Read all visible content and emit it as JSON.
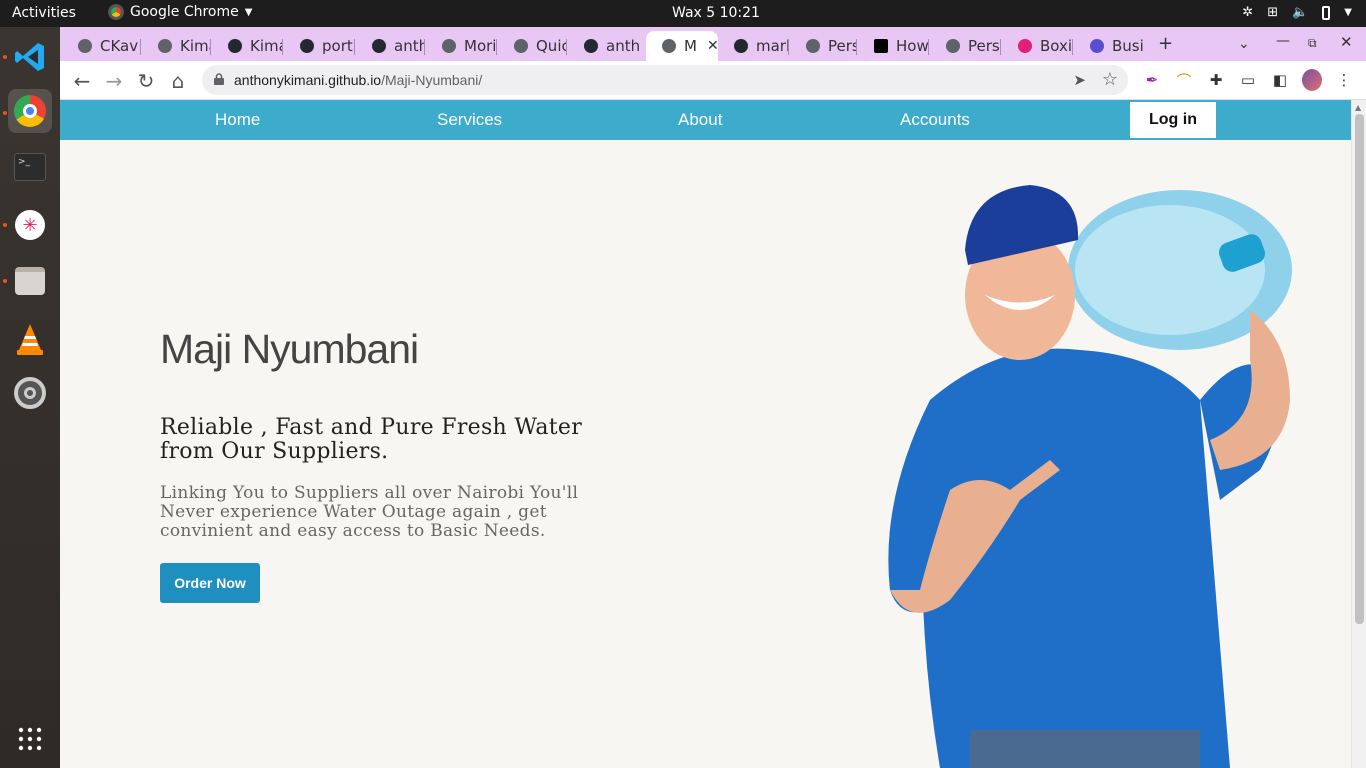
{
  "system": {
    "activities": "Activities",
    "app_name": "Google Chrome",
    "clock": "Wax 5  10:21"
  },
  "tabs": [
    {
      "label": "CKav",
      "icon": "globe-icon"
    },
    {
      "label": "Kima",
      "icon": "globe-icon"
    },
    {
      "label": "Kima",
      "icon": "github-icon"
    },
    {
      "label": "port",
      "icon": "github-icon"
    },
    {
      "label": "anth",
      "icon": "github-icon"
    },
    {
      "label": "Mori",
      "icon": "globe-icon"
    },
    {
      "label": "Quic",
      "icon": "globe-icon"
    },
    {
      "label": "anth",
      "icon": "github-icon"
    },
    {
      "label": "M",
      "icon": "globe-icon",
      "active": true
    },
    {
      "label": "mark",
      "icon": "github-icon"
    },
    {
      "label": "Pers",
      "icon": "globe-icon"
    },
    {
      "label": "How",
      "icon": "dev-icon"
    },
    {
      "label": "Pers",
      "icon": "globe-icon"
    },
    {
      "label": "Boxi",
      "icon": "cube-icon"
    },
    {
      "label": "Busi",
      "icon": "bot-icon"
    }
  ],
  "toolbar": {
    "url_host": "anthonykimani.github.io",
    "url_path": "/Maji-Nyumbani/"
  },
  "site": {
    "nav": [
      "Home",
      "Services",
      "About",
      "Accounts"
    ],
    "login": "Log in",
    "title": "Maji Nyumbani",
    "subtitle": "Reliable , Fast and Pure Fresh Water from Our Suppliers.",
    "description": "Linking You to Suppliers all over Nairobi You'll Never experience Water Outage again , get convinient and easy access to Basic Needs.",
    "cta": "Order Now"
  },
  "colors": {
    "nav_bg": "#3dabcb",
    "cta_bg": "#1f8fbf",
    "tabstrip_bg": "#e9c7f5"
  }
}
